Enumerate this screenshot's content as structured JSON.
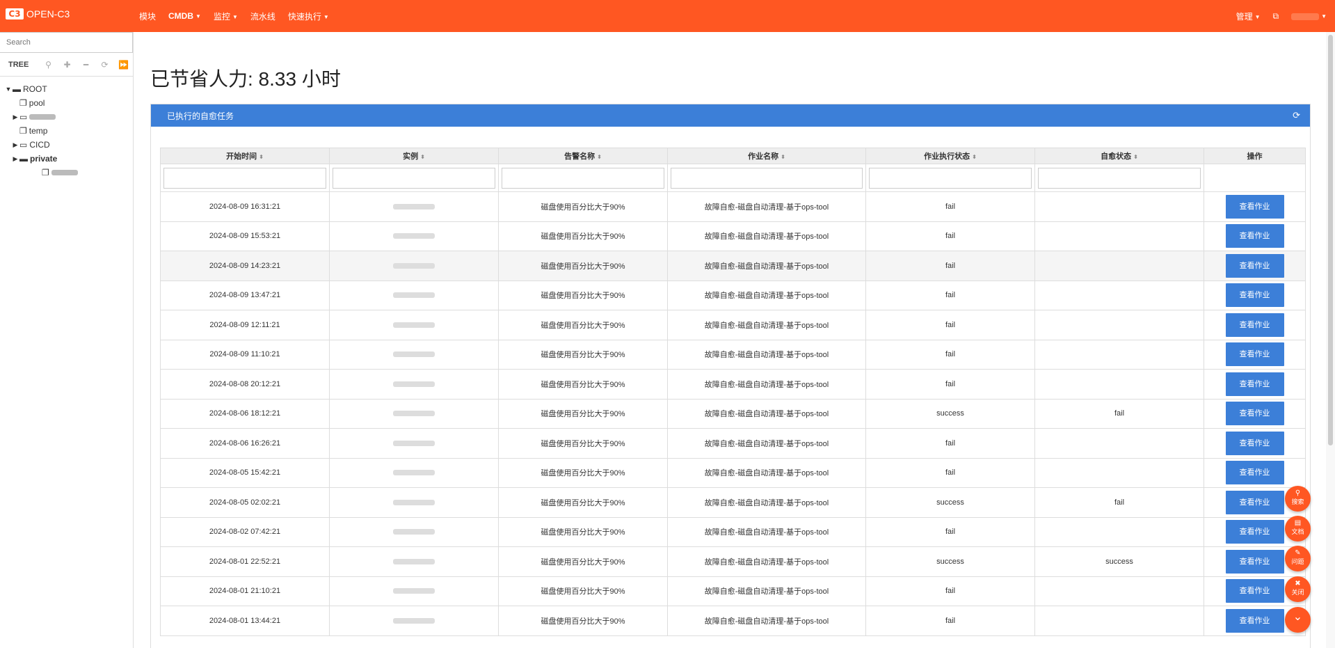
{
  "app": {
    "brand_logo": "C3",
    "brand_name": "OPEN-C3"
  },
  "nav": {
    "items": [
      {
        "label": "模块",
        "dropdown": false,
        "bold": false
      },
      {
        "label": "CMDB",
        "dropdown": true,
        "bold": true
      },
      {
        "label": "监控",
        "dropdown": true,
        "bold": false
      },
      {
        "label": "流水线",
        "dropdown": false,
        "bold": false
      },
      {
        "label": "快速执行",
        "dropdown": true,
        "bold": false
      }
    ],
    "right": {
      "admin_label": "管理"
    }
  },
  "sidebar": {
    "search_placeholder": "Search",
    "tree_label": "TREE",
    "tree": [
      {
        "label": "ROOT",
        "level": 0,
        "expanded": true
      },
      {
        "label": "pool",
        "level": 1
      },
      {
        "label": "",
        "level": 1,
        "collapsed": true,
        "blurred": true
      },
      {
        "label": "temp",
        "level": 1
      },
      {
        "label": "CICD",
        "level": 1,
        "collapsed": true
      },
      {
        "label": "private",
        "level": 1,
        "collapsed": true,
        "bold": true
      },
      {
        "label": "",
        "level": 2,
        "blurred": true
      }
    ]
  },
  "main": {
    "headline": "已节省人力: 8.33 小时",
    "panel_title": "已执行的自愈任务",
    "columns": [
      "开始时间",
      "实例",
      "告警名称",
      "作业名称",
      "作业执行状态",
      "自愈状态",
      "操作"
    ],
    "action_label": "查看作业",
    "rows": [
      {
        "time": "2024-08-09 16:31:21",
        "alert": "磁盘使用百分比大于90%",
        "job": "故障自愈-磁盘自动清理-基于ops-tool",
        "job_status": "fail",
        "heal_status": ""
      },
      {
        "time": "2024-08-09 15:53:21",
        "alert": "磁盘使用百分比大于90%",
        "job": "故障自愈-磁盘自动清理-基于ops-tool",
        "job_status": "fail",
        "heal_status": ""
      },
      {
        "time": "2024-08-09 14:23:21",
        "alert": "磁盘使用百分比大于90%",
        "job": "故障自愈-磁盘自动清理-基于ops-tool",
        "job_status": "fail",
        "heal_status": ""
      },
      {
        "time": "2024-08-09 13:47:21",
        "alert": "磁盘使用百分比大于90%",
        "job": "故障自愈-磁盘自动清理-基于ops-tool",
        "job_status": "fail",
        "heal_status": ""
      },
      {
        "time": "2024-08-09 12:11:21",
        "alert": "磁盘使用百分比大于90%",
        "job": "故障自愈-磁盘自动清理-基于ops-tool",
        "job_status": "fail",
        "heal_status": ""
      },
      {
        "time": "2024-08-09 11:10:21",
        "alert": "磁盘使用百分比大于90%",
        "job": "故障自愈-磁盘自动清理-基于ops-tool",
        "job_status": "fail",
        "heal_status": ""
      },
      {
        "time": "2024-08-08 20:12:21",
        "alert": "磁盘使用百分比大于90%",
        "job": "故障自愈-磁盘自动清理-基于ops-tool",
        "job_status": "fail",
        "heal_status": ""
      },
      {
        "time": "2024-08-06 18:12:21",
        "alert": "磁盘使用百分比大于90%",
        "job": "故障自愈-磁盘自动清理-基于ops-tool",
        "job_status": "success",
        "heal_status": "fail"
      },
      {
        "time": "2024-08-06 16:26:21",
        "alert": "磁盘使用百分比大于90%",
        "job": "故障自愈-磁盘自动清理-基于ops-tool",
        "job_status": "fail",
        "heal_status": ""
      },
      {
        "time": "2024-08-05 15:42:21",
        "alert": "磁盘使用百分比大于90%",
        "job": "故障自愈-磁盘自动清理-基于ops-tool",
        "job_status": "fail",
        "heal_status": ""
      },
      {
        "time": "2024-08-05 02:02:21",
        "alert": "磁盘使用百分比大于90%",
        "job": "故障自愈-磁盘自动清理-基于ops-tool",
        "job_status": "success",
        "heal_status": "fail"
      },
      {
        "time": "2024-08-02 07:42:21",
        "alert": "磁盘使用百分比大于90%",
        "job": "故障自愈-磁盘自动清理-基于ops-tool",
        "job_status": "fail",
        "heal_status": ""
      },
      {
        "time": "2024-08-01 22:52:21",
        "alert": "磁盘使用百分比大于90%",
        "job": "故障自愈-磁盘自动清理-基于ops-tool",
        "job_status": "success",
        "heal_status": "success"
      },
      {
        "time": "2024-08-01 21:10:21",
        "alert": "磁盘使用百分比大于90%",
        "job": "故障自愈-磁盘自动清理-基于ops-tool",
        "job_status": "fail",
        "heal_status": ""
      },
      {
        "time": "2024-08-01 13:44:21",
        "alert": "磁盘使用百分比大于90%",
        "job": "故障自愈-磁盘自动清理-基于ops-tool",
        "job_status": "fail",
        "heal_status": ""
      }
    ]
  },
  "float_buttons": [
    {
      "label": "搜索",
      "icon": "search-icon"
    },
    {
      "label": "文档",
      "icon": "book-icon"
    },
    {
      "label": "问题",
      "icon": "edit-icon"
    },
    {
      "label": "关闭",
      "icon": "close-icon"
    },
    {
      "label": "",
      "icon": "chevron-double-down-icon"
    }
  ],
  "colors": {
    "primary": "#ff5722",
    "accent": "#3c7fd8"
  }
}
